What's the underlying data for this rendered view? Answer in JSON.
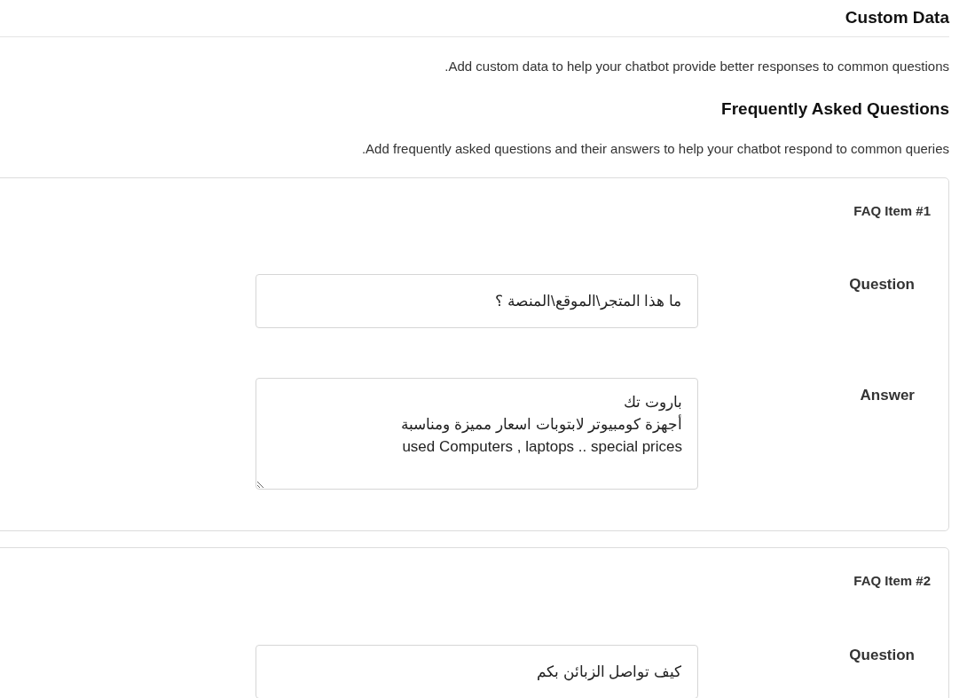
{
  "header": {
    "title": "Custom Data"
  },
  "intro": ".Add custom data to help your chatbot provide better responses to common questions",
  "faq_section": {
    "title": "Frequently Asked Questions",
    "description": ".Add frequently asked questions and their answers to help your chatbot respond to common queries",
    "items": [
      {
        "title": "FAQ Item #1",
        "fields": [
          {
            "kind": "input",
            "label": "Question",
            "value": "ما هذا المتجر\\الموقع\\المنصة ؟"
          },
          {
            "kind": "textarea",
            "label": "Answer",
            "value": "باروت تك\nأجهزة كومبيوتر لابتوبات اسعار مميزة ومناسبة\nused Computers , laptops .. special prices"
          }
        ]
      },
      {
        "title": "FAQ Item #2",
        "fields": [
          {
            "kind": "input",
            "label": "Question",
            "value": "كيف تواصل الزبائن بكم"
          }
        ]
      }
    ]
  }
}
